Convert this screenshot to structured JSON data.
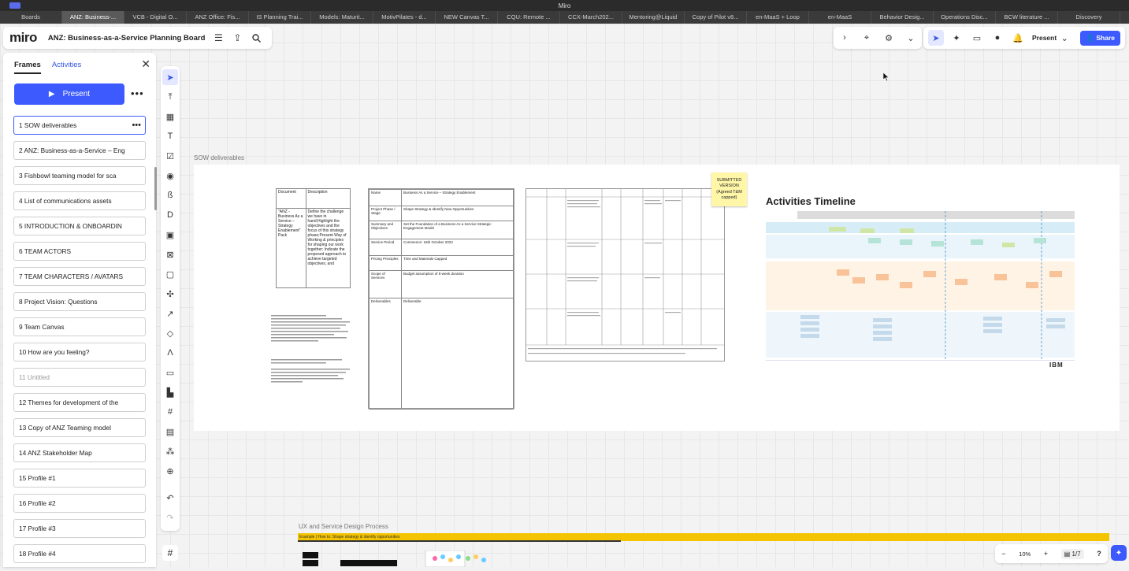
{
  "window": {
    "title": "Miro"
  },
  "tabs": [
    "Boards",
    "ANZ: Business-...",
    "VCB - Digital O...",
    "ANZ Office: Fis...",
    "IS Planning Trai...",
    "Models: Maturit...",
    "MotivPilates - d...",
    "NEW Canvas T...",
    "CQU: Remote ...",
    "CCX-March202...",
    "Mentoring@Liquid",
    "Copy of Pilot v8...",
    "en-MaaS + Loop",
    "en-MaaS",
    "Behavior Desig...",
    "Operations Disc...",
    "BCW literature ...",
    "Discovery"
  ],
  "board": {
    "logo": "miro",
    "title": "ANZ: Business-as-a-Service Planning Board"
  },
  "toolbar": {
    "present": "Present",
    "share": "Share"
  },
  "panel": {
    "tab_frames": "Frames",
    "tab_activities": "Activities",
    "present_label": "Present",
    "frames": [
      "1  SOW deliverables",
      "2  ANZ: Business-as-a-Service – Eng",
      "3  Fishbowl teaming model for sca",
      "4  List of communications assets",
      "5  INTRODUCTION & ONBOARDIN",
      "6  TEAM ACTORS",
      "7  TEAM CHARACTERS / AVATARS",
      "8  Project Vision: Questions",
      "9  Team Canvas",
      "10  How are you feeling?",
      "11  Untitled",
      "12  Themes for development of the",
      "13  Copy of ANZ Teaming model",
      "14  ANZ Stakeholder Map",
      "15  Profile #1",
      "16  Profile #2",
      "17  Profile #3",
      "18  Profile #4"
    ]
  },
  "canvas": {
    "frame1_label": "SOW deliverables",
    "frame2_label": "UX and Service Design Process",
    "doc1": {
      "h1": "Document",
      "h2": "Description",
      "c1": "\"ANZ - Business As a Service – Strategy Enablement\" Pack",
      "c2": "Define the challenge we have in hand;Highlight the objectives and the focus of this strategy phase;Present Way of Working & principles for shaping our work together; Indicate the proposed approach to achieve targeted objectives; and"
    },
    "doc2": {
      "r1a": "Name",
      "r1b": "Business As a Service – Strategy Enablement",
      "r2a": "Project Phase / Stage",
      "r2b": "Shape Strategy & Identify New Opportunities",
      "r3a": "Summary and Objectives",
      "r3b": "Set the Foundation of a Business As a Service Strategic Engagement Model",
      "r4a": "Service Period",
      "r4b": "Commence: 16th October 2023",
      "r5a": "Pricing Principles",
      "r5b": "Time and Materials Capped",
      "r6a": "Scope of Services",
      "r6b": "Budget assumption of 8-week duration",
      "r7a": "Deliverables",
      "r7b": "Deliverable"
    },
    "sticky": "SUBMITTED VERSION (Agreed T&M capped)",
    "timeline_title": "Activities Timeline",
    "ibm": "IBM",
    "ux_sub": "Example | How to: Shape strategy & identify opportunities"
  },
  "zoom": {
    "level": "10%",
    "page": "1/7"
  }
}
